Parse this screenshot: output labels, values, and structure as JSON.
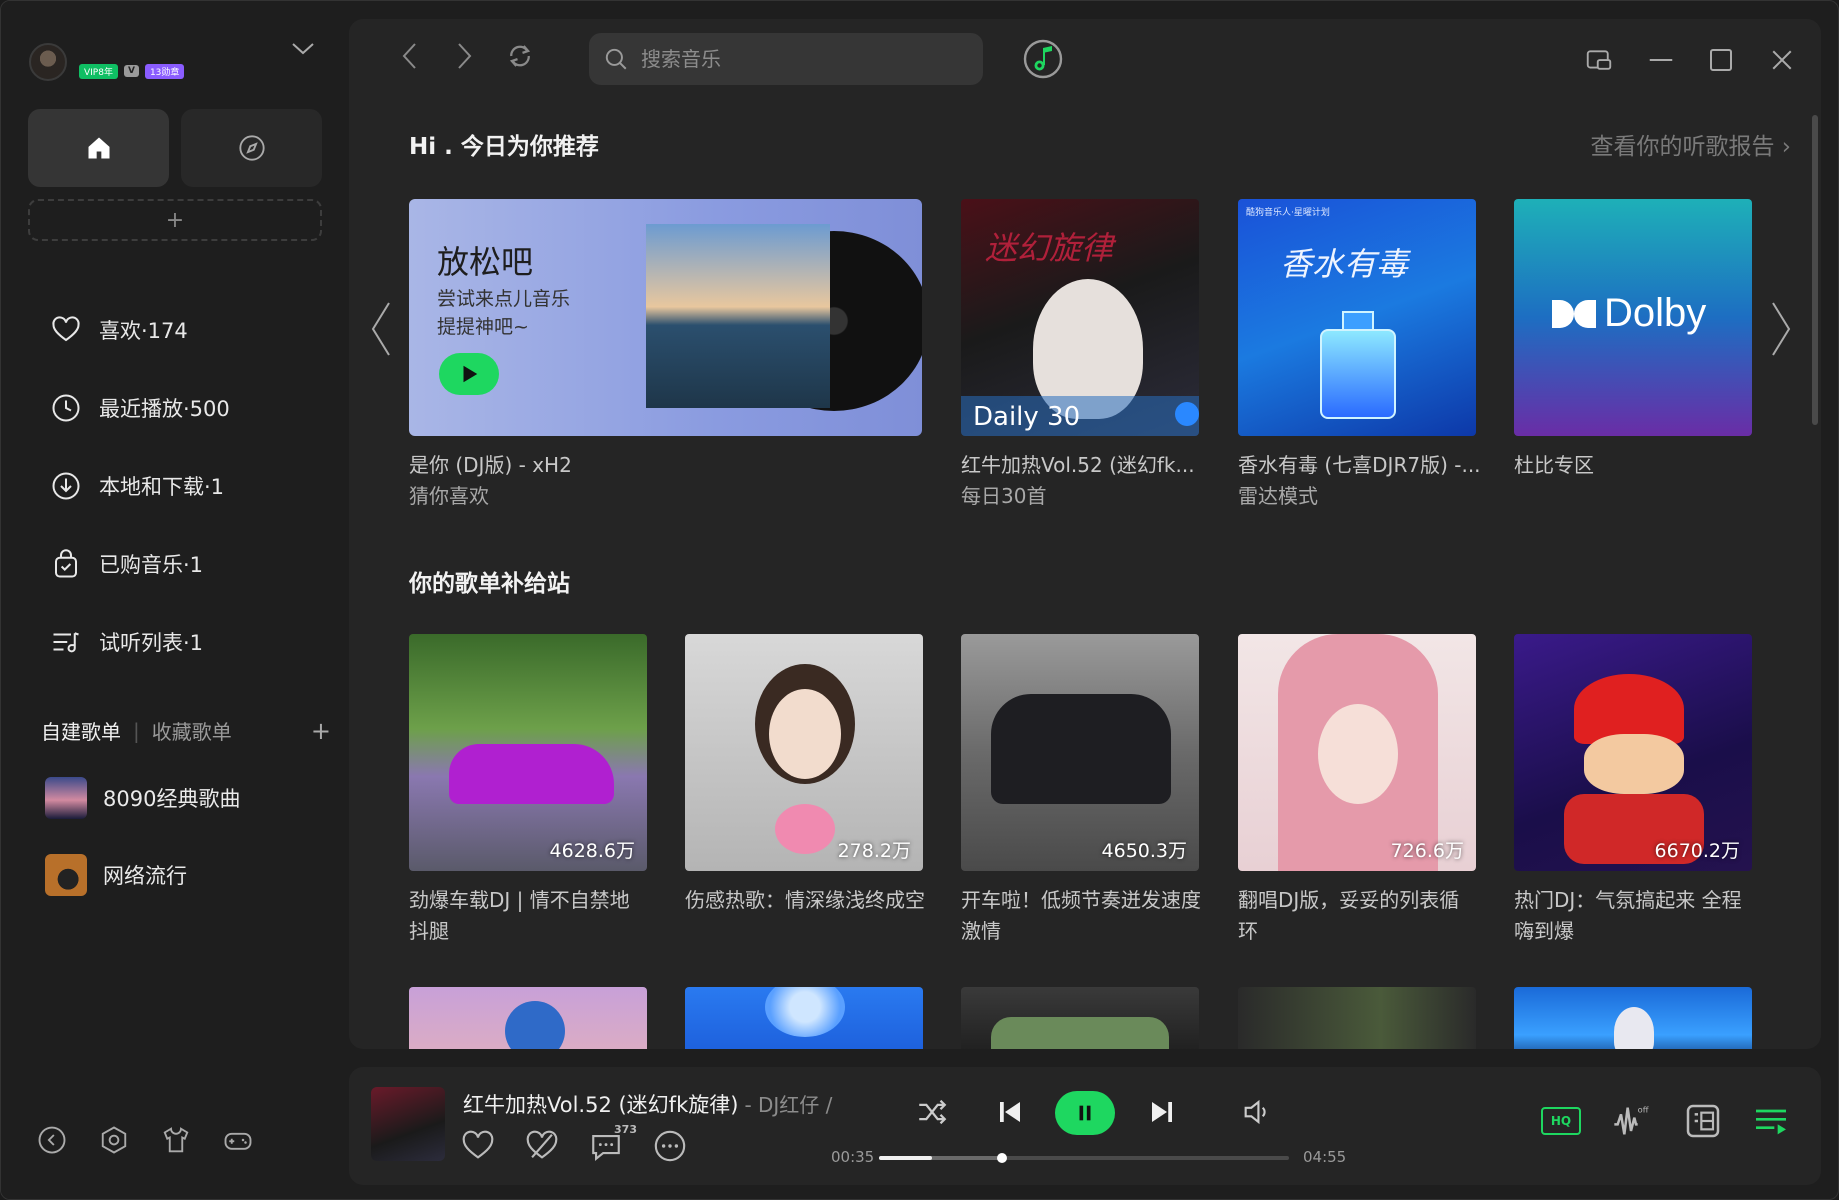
{
  "sidebar": {
    "profile": {
      "badge_vip": "VIP8年",
      "badge_v": "V",
      "badge_hz": "13勋章"
    },
    "add_tab_label": "+",
    "nav": [
      {
        "label": "喜欢·174",
        "icon": "heart-icon"
      },
      {
        "label": "最近播放·500",
        "icon": "clock-icon"
      },
      {
        "label": "本地和下载·1",
        "icon": "download-icon"
      },
      {
        "label": "已购音乐·1",
        "icon": "bag-icon"
      },
      {
        "label": "试听列表·1",
        "icon": "playlist-icon"
      }
    ],
    "playlist_tabs": {
      "own": "自建歌单",
      "separator": "|",
      "fav": "收藏歌单",
      "add": "+"
    },
    "playlists": [
      {
        "name": "8090经典歌曲"
      },
      {
        "name": "网络流行"
      }
    ]
  },
  "topbar": {
    "search_placeholder": "搜索音乐"
  },
  "recommend": {
    "title": "Hi . 今日为你推荐",
    "report_link": "查看你的听歌报告 ›",
    "feature": {
      "headline": "放松吧",
      "subtitle": "尝试来点儿音乐提提神吧~",
      "line1": "是你 (DJ版) - xH2",
      "line2": "猜你喜欢"
    },
    "cards": [
      {
        "line1": "红牛加热Vol.52 (迷幻fk...",
        "line2": "每日30首",
        "overlay": "Daily 30",
        "art_text": "迷幻旋律"
      },
      {
        "line1": "香水有毒 (七喜DJR7版) -...",
        "line2": "雷达模式",
        "art_text": "香水有毒",
        "art_top": "酷狗音乐人·星曜计划"
      },
      {
        "line1": "杜比专区",
        "line2": "",
        "art_text": "Dolby"
      }
    ]
  },
  "supply": {
    "title": "你的歌单补给站",
    "cards": [
      {
        "count": "4628.6万",
        "line1": "劲爆车载DJ | 情不自禁地",
        "line2": "抖腿"
      },
      {
        "count": "278.2万",
        "line1": "伤感热歌：情深缘浅终成空",
        "line2": ""
      },
      {
        "count": "4650.3万",
        "line1": "开车啦！低频节奏迸发速度",
        "line2": "激情"
      },
      {
        "count": "726.6万",
        "line1": "翻唱DJ版，妥妥的列表循",
        "line2": "环"
      },
      {
        "count": "6670.2万",
        "line1": "热门DJ：气氛搞起来 全程",
        "line2": "嗨到爆"
      }
    ]
  },
  "player": {
    "title": "红牛加热Vol.52 (迷幻fk旋律)",
    "artist": "- DJ红仔 /",
    "comment_count": "373",
    "time_current": "00:35",
    "time_total": "04:55",
    "progress": 0.3,
    "buffered": 0.13,
    "quality": "HQ"
  },
  "colors": {
    "accent": "#1ed760",
    "background": "#1e1e1e",
    "panel": "#252525"
  }
}
